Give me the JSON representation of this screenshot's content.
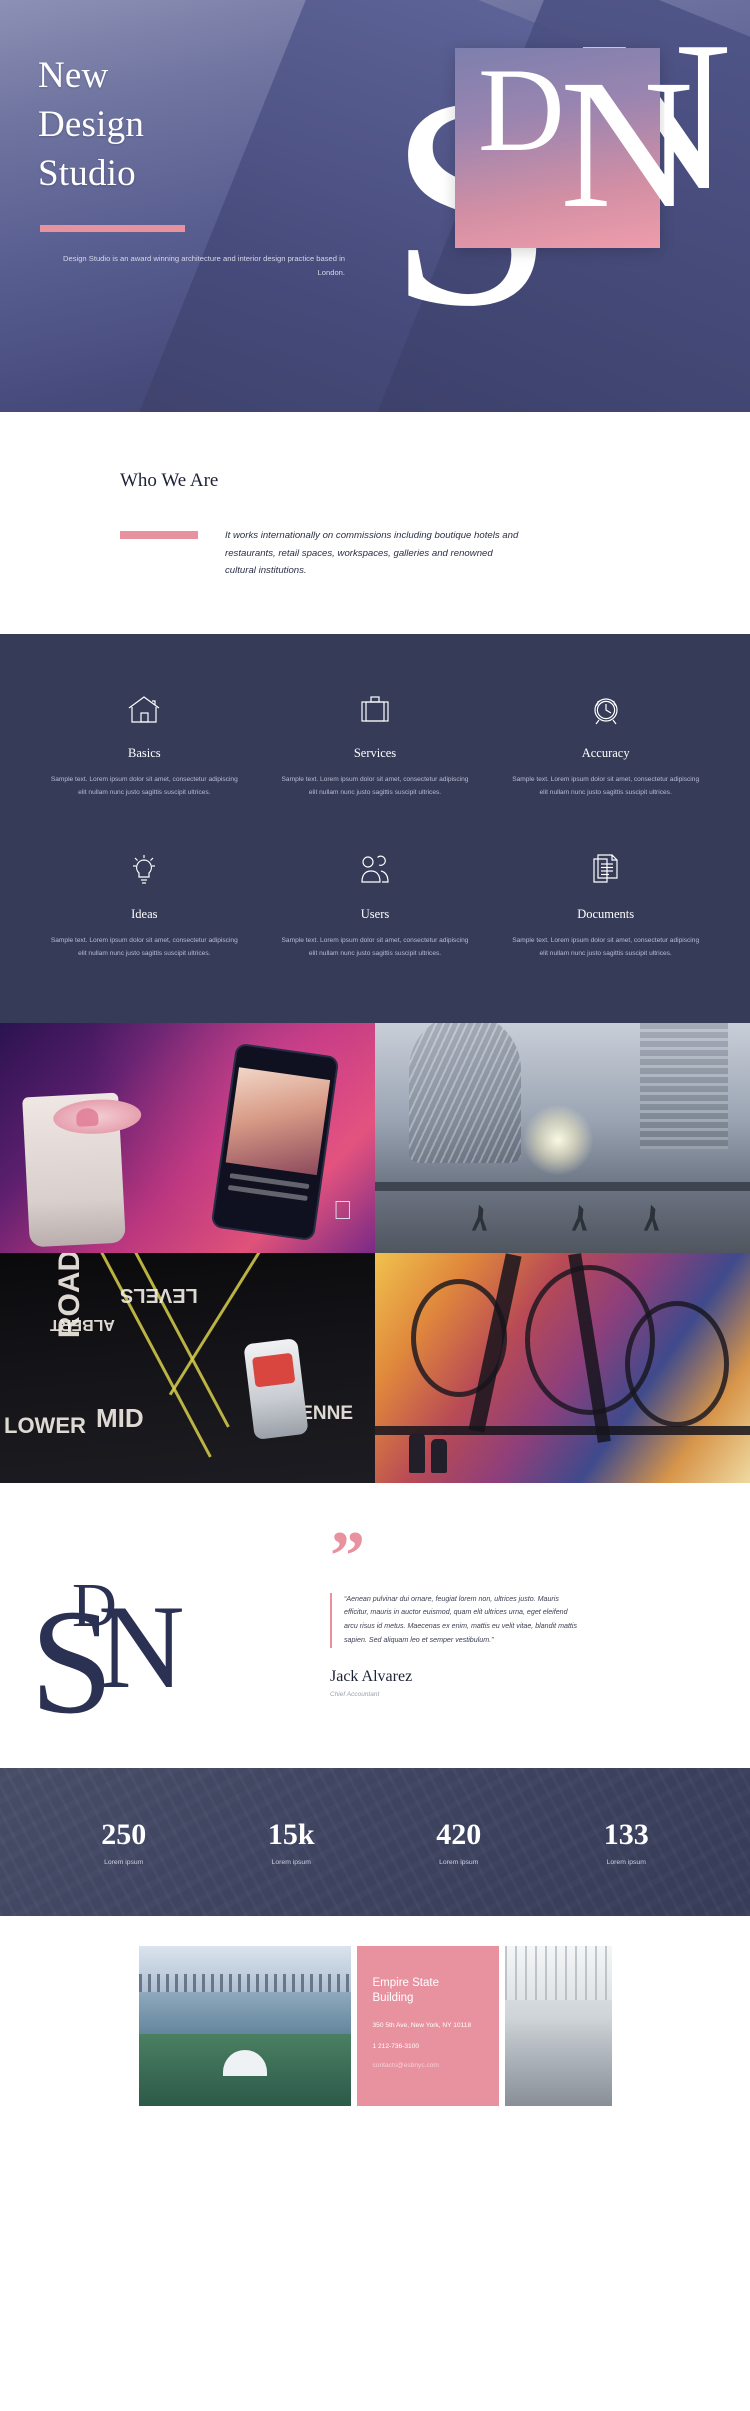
{
  "hero": {
    "title_lines": [
      "New",
      "Design",
      "Studio"
    ],
    "tagline": "Design Studio is an award winning architecture and interior design practice based in London.",
    "monogram": {
      "letter_d": "D",
      "letter_s": "S",
      "letter_n": "N"
    },
    "accent_color": "#e8919f"
  },
  "who": {
    "heading": "Who We Are",
    "paragraph": "It works internationally on commissions including boutique hotels and restaurants, retail spaces, workspaces, galleries and renowned cultural institutions."
  },
  "features": {
    "body_color": "#363b58",
    "items": [
      {
        "icon": "home-icon",
        "title": "Basics",
        "text": "Sample text. Lorem ipsum dolor sit amet, consectetur adipiscing elit nullam nunc justo sagittis suscipit ultrices."
      },
      {
        "icon": "briefcase-icon",
        "title": "Services",
        "text": "Sample text. Lorem ipsum dolor sit amet, consectetur adipiscing elit nullam nunc justo sagittis suscipit ultrices."
      },
      {
        "icon": "alarm-clock-icon",
        "title": "Accuracy",
        "text": "Sample text. Lorem ipsum dolor sit amet, consectetur adipiscing elit nullam nunc justo sagittis suscipit ultrices."
      },
      {
        "icon": "lightbulb-icon",
        "title": "Ideas",
        "text": "Sample text. Lorem ipsum dolor sit amet, consectetur adipiscing elit nullam nunc justo sagittis suscipit ultrices."
      },
      {
        "icon": "users-icon",
        "title": "Users",
        "text": "Sample text. Lorem ipsum dolor sit amet, consectetur adipiscing elit nullam nunc justo sagittis suscipit ultrices."
      },
      {
        "icon": "documents-icon",
        "title": "Documents",
        "text": "Sample text. Lorem ipsum dolor sit amet, consectetur adipiscing elit nullam nunc justo sagittis suscipit ultrices."
      }
    ]
  },
  "gallery": {
    "images": [
      {
        "name": "coffee-and-phone-neon-photo"
      },
      {
        "name": "cyclists-modern-architecture-photo"
      },
      {
        "name": "night-street-taxi-photo"
      },
      {
        "name": "graffiti-mural-street-photo"
      }
    ]
  },
  "testimonial": {
    "quote_mark": "”",
    "quote": "“Aenean pulvinar dui ornare, feugiat lorem non, ultrices justo. Mauris efficitur, mauris in auctor euismod, quam elit ultrices urna, eget eleifend arcu risus id metus. Maecenas ex enim, mattis eu velit vitae, blandit mattis sapien. Sed aliquam leo et semper vestibulum.”",
    "author": "Jack Alvarez",
    "role": "Chief Accountant",
    "monogram": {
      "letter_d": "D",
      "letter_s": "S",
      "letter_n": "N"
    }
  },
  "stats": {
    "items": [
      {
        "value": "250",
        "label": "Lorem ipsum"
      },
      {
        "value": "15k",
        "label": "Lorem ipsum"
      },
      {
        "value": "420",
        "label": "Lorem ipsum"
      },
      {
        "value": "133",
        "label": "Lorem ipsum"
      }
    ]
  },
  "contact": {
    "photo_left": "city-waterfront-aerial-photo",
    "photo_right": "interior-atrium-photo",
    "card": {
      "title": "Empire State Building",
      "address": "350 5th Ave, New York, NY 10118",
      "phone": "1 212-736-3100",
      "email": "contacts@esbnyc.com",
      "bg_color": "#e8919f"
    }
  }
}
